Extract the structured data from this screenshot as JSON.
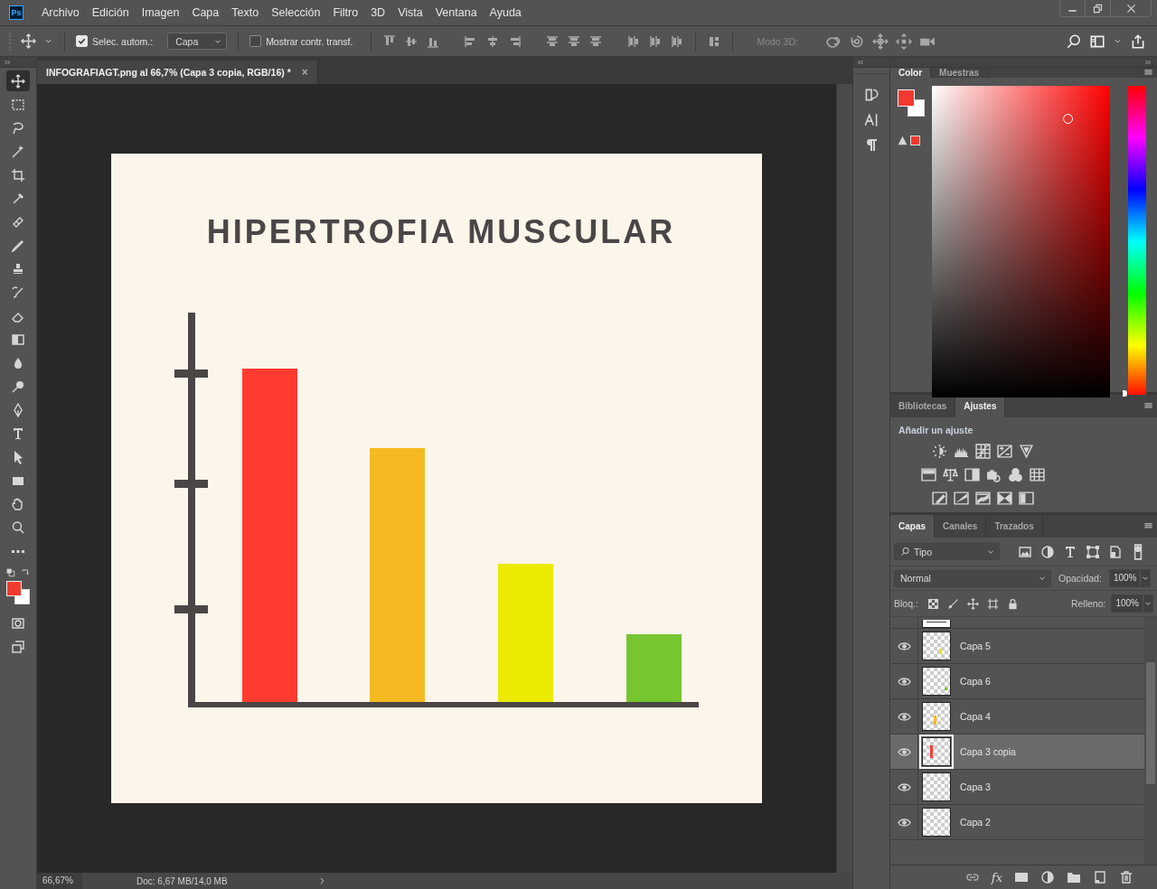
{
  "app": {
    "logo": "Ps"
  },
  "menu": [
    "Archivo",
    "Edición",
    "Imagen",
    "Capa",
    "Texto",
    "Selección",
    "Filtro",
    "3D",
    "Vista",
    "Ventana",
    "Ayuda"
  ],
  "options_bar": {
    "auto_select": {
      "label": "Selec. autom.:",
      "checked": true
    },
    "target": "Capa",
    "show_transform": {
      "label": "Mostrar contr. transf.",
      "checked": false
    },
    "mode_3d_label": "Modo 3D:"
  },
  "document": {
    "tab_title": "INFOGRAFIAGT.png al 66,7% (Capa 3 copia, RGB/16) *",
    "close": "×",
    "artwork_title": "HIPERTROFIA MUSCULAR"
  },
  "status_bar": {
    "zoom": "66,67%",
    "doc_info": "Doc: 6,67 MB/14,0 MB"
  },
  "color_panel": {
    "tabs": [
      {
        "label": "Color",
        "selected": true
      },
      {
        "label": "Muestras",
        "selected": false
      }
    ],
    "hue_slider": {
      "level": 0
    }
  },
  "adjustments_panel": {
    "tabs": [
      {
        "label": "Bibliotecas",
        "selected": false
      },
      {
        "label": "Ajustes",
        "selected": true
      }
    ],
    "heading": "Añadir un ajuste"
  },
  "layers_panel": {
    "tabs": [
      {
        "label": "Capas",
        "selected": true
      },
      {
        "label": "Canales",
        "selected": false
      },
      {
        "label": "Trazados",
        "selected": false
      }
    ],
    "filter": "Tipo",
    "blend_mode": "Normal",
    "opacity_label": "Opacidad:",
    "opacity": "100%",
    "lock_label": "Bloq.:",
    "fill_label": "Relleno:",
    "fill": "100%",
    "layers": [
      {
        "name": "Capa 5",
        "visible": true,
        "selected": false,
        "color": "#e8e800"
      },
      {
        "name": "Capa 6",
        "visible": true,
        "selected": false,
        "color": "#76c043"
      },
      {
        "name": "Capa 4",
        "visible": true,
        "selected": false,
        "color": "#f5b921"
      },
      {
        "name": "Capa 3 copia",
        "visible": true,
        "selected": true,
        "color": "#ff3b30"
      },
      {
        "name": "Capa 3",
        "visible": true,
        "selected": false
      },
      {
        "name": "Capa 2",
        "visible": true,
        "selected": false
      }
    ],
    "fx_button": "fx"
  }
}
